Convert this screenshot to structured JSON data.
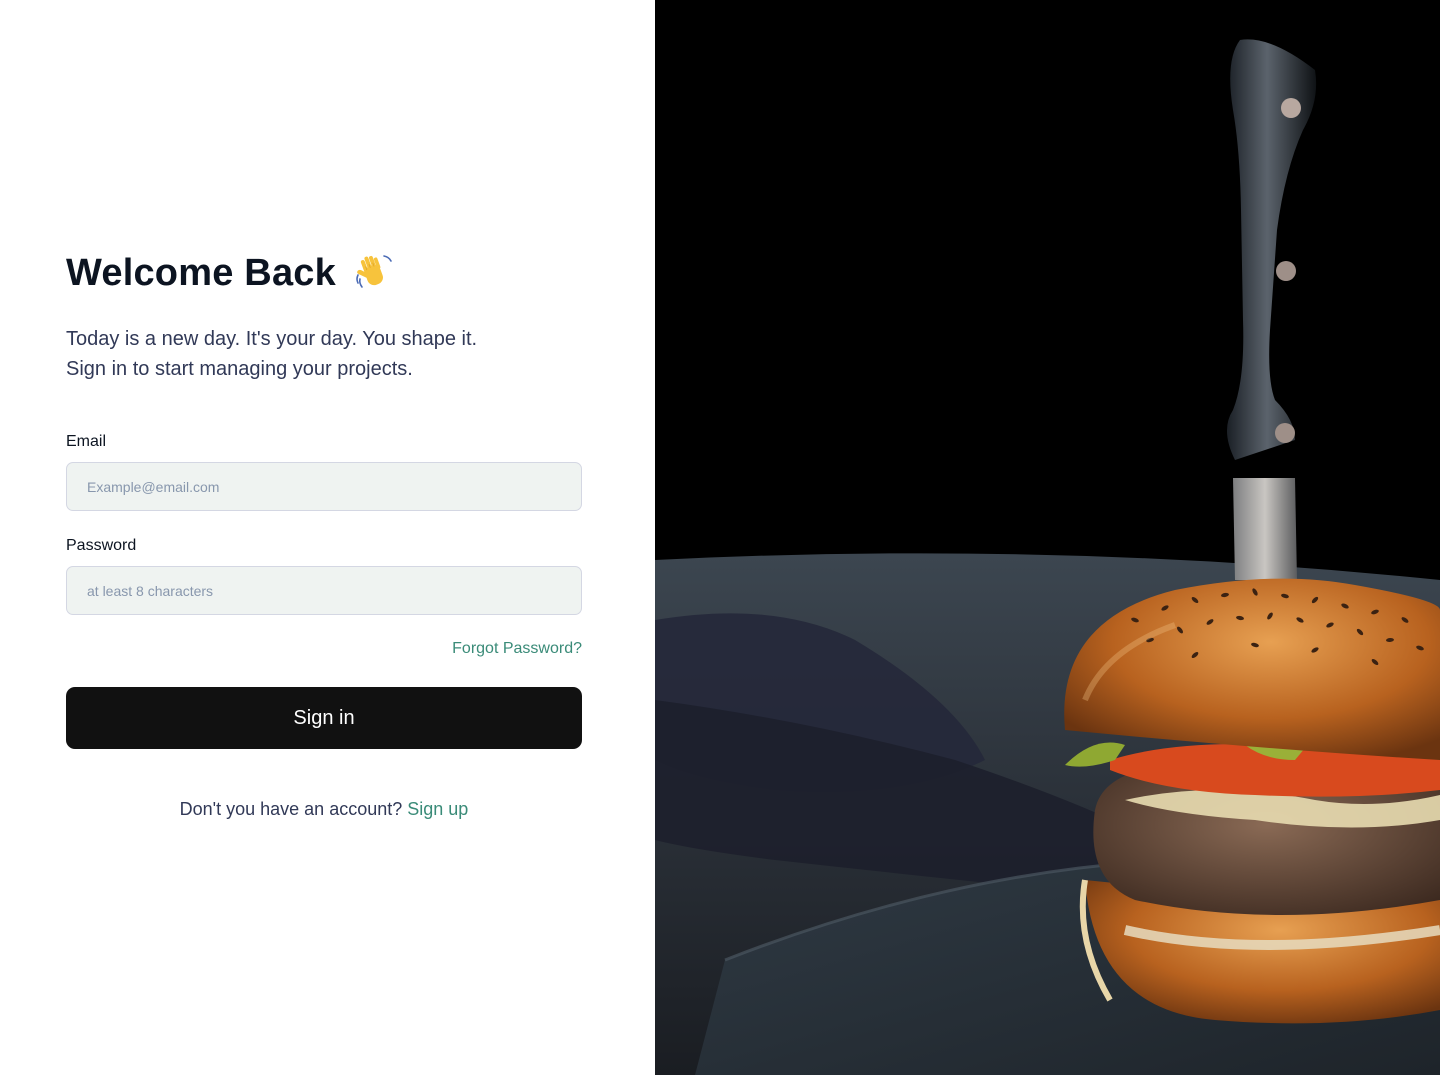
{
  "login": {
    "title": "Welcome Back",
    "title_emoji_icon": "waving-hand-icon",
    "subtitle_line1": "Today is a new day. It's your day. You shape it.",
    "subtitle_line2": "Sign in to start managing your projects.",
    "email_label": "Email",
    "email_placeholder": "Example@email.com",
    "password_label": "Password",
    "password_placeholder": "at least 8 characters",
    "forgot_password": "Forgot Password?",
    "sign_in_button": "Sign in",
    "no_account_text": "Don't you have an account?",
    "sign_up_link": "Sign up"
  },
  "colors": {
    "accent": "#3a8b78",
    "button_bg": "#111111",
    "input_bg": "#eff3f1",
    "title": "#0c1421"
  },
  "hero_image": {
    "subject": "burger-with-knife-image"
  }
}
